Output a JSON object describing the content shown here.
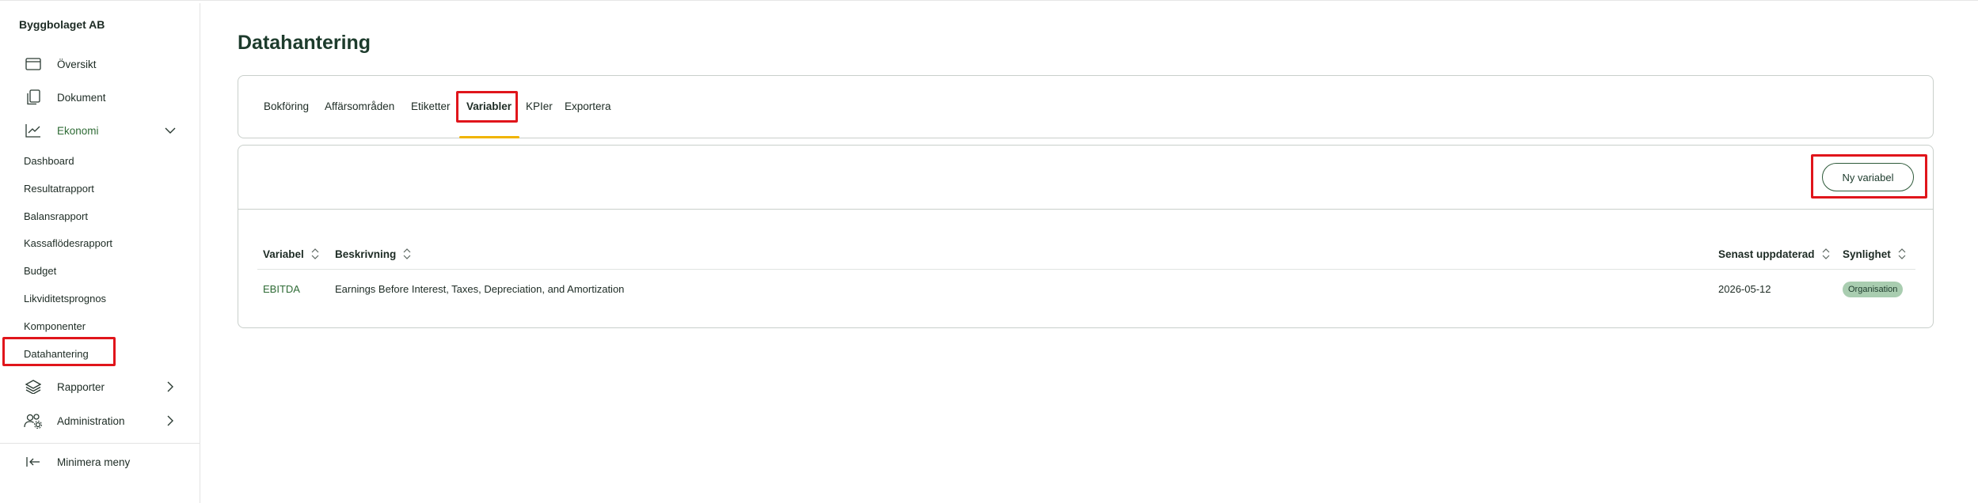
{
  "sidebar": {
    "org_name": "Byggbolaget AB",
    "items": [
      {
        "label": "Översikt",
        "icon": "window-icon"
      },
      {
        "label": "Dokument",
        "icon": "documents-icon"
      },
      {
        "label": "Ekonomi",
        "icon": "chart-line-icon"
      }
    ],
    "sub_items": [
      "Dashboard",
      "Resultatrapport",
      "Balansrapport",
      "Kassaflödesrapport",
      "Budget",
      "Likviditetsprognos",
      "Komponenter",
      "Datahantering"
    ],
    "rapporter_label": "Rapporter",
    "administration_label": "Administration",
    "minimize_label": "Minimera meny",
    "active_sub_item": "Datahantering"
  },
  "main": {
    "title": "Datahantering",
    "tabs": [
      "Bokföring",
      "Affärsområden",
      "Etiketter",
      "Variabler",
      "KPIer",
      "Exportera"
    ],
    "active_tab": "Variabler",
    "new_button_label": "Ny variabel",
    "table": {
      "headers": [
        "Variabel",
        "Beskrivning",
        "Senast uppdaterad",
        "Synlighet"
      ],
      "rows": [
        {
          "variable": "EBITDA",
          "description": "Earnings Before Interest, Taxes, Depreciation, and Amortization",
          "updated": "2026-05-12",
          "visibility": "Organisation"
        }
      ]
    }
  },
  "colors": {
    "accent_green": "#2e6b35",
    "tab_underline": "#f0b400",
    "highlight_red": "#e0151b",
    "badge_bg": "#a9cdb0"
  }
}
